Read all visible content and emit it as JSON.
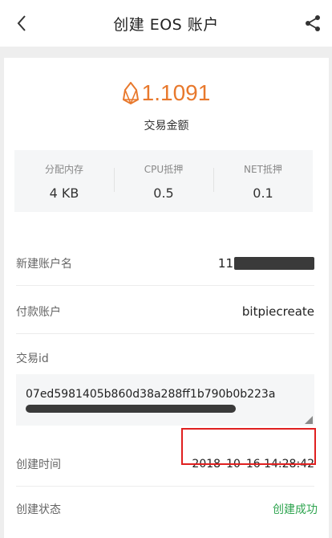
{
  "header": {
    "title": "创建 EOS 账户",
    "back_icon": "chevron-left-icon",
    "share_icon": "share-icon"
  },
  "summary": {
    "amount": "1.1091",
    "amount_label": "交易金额",
    "token_icon": "eos-logo-icon",
    "accent_color": "#e8792d"
  },
  "stats": [
    {
      "label": "分配内存",
      "value": "4 KB"
    },
    {
      "label": "CPU抵押",
      "value": "0.5"
    },
    {
      "label": "NET抵押",
      "value": "0.1"
    }
  ],
  "details": {
    "new_account_label": "新建账户名",
    "new_account_value": "11",
    "payer_label": "付款账户",
    "payer_value": "bitpiecreate",
    "txid_label": "交易id",
    "txid_value": "07ed5981405b860d38a288ff1b790b0b223a",
    "created_time_label": "创建时间",
    "created_time_value": "2018–10–16 14:28:42",
    "status_label": "创建状态",
    "status_value": "创建成功",
    "status_color": "#2ea44f",
    "highlight_color": "#e02020"
  }
}
